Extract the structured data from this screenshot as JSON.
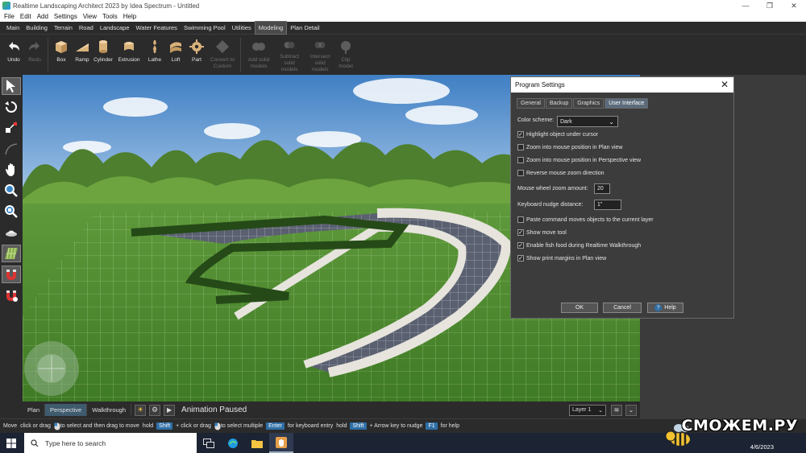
{
  "window": {
    "title": "Realtime Landscaping Architect 2023 by Idea Spectrum - Untitled",
    "controls": [
      "—",
      "❐",
      "✕"
    ]
  },
  "menu": [
    "File",
    "Edit",
    "Add",
    "Settings",
    "View",
    "Tools",
    "Help"
  ],
  "tabs": [
    "Main",
    "Building",
    "Terrain",
    "Road",
    "Landscape",
    "Water Features",
    "Swimming Pool",
    "Utilities",
    "Modeling",
    "Plan Detail"
  ],
  "active_tab": "Modeling",
  "toolbar": {
    "undo": "Undo",
    "redo": "Redo",
    "box": "Box",
    "ramp": "Ramp",
    "cylinder": "Cylinder",
    "extrusion": "Extrusion",
    "lathe": "Lathe",
    "loft": "Loft",
    "part": "Part",
    "convert1": "Convert to",
    "convert2": "Custom",
    "add1": "Add solid",
    "add2": "models",
    "sub1": "Subtract solid",
    "sub2": "models",
    "int1": "Intersect solid",
    "int2": "models",
    "clip1": "Clip",
    "clip2": "model"
  },
  "viewport_tabs": {
    "plan": "Plan",
    "perspective": "Perspective",
    "walkthrough": "Walkthrough"
  },
  "animation_status": "Animation Paused",
  "layer": "Layer 1",
  "status": {
    "mode": "Move",
    "t1": "click or drag",
    "t2": "to select and then drag to move",
    "t3": "hold",
    "k1": "Shift",
    "t4": "+ click or drag",
    "t5": "to select multiple",
    "k2": "Enter",
    "t6": "for keyboard entry",
    "t7": "hold",
    "k3": "Shift",
    "t8": "+ Arrow key to nudge",
    "k4": "F1",
    "t9": "for help"
  },
  "taskbar": {
    "search_placeholder": "Type here to search",
    "date": "4/6/2023",
    "watermark": "СМОЖЕМ.РУ"
  },
  "dialog": {
    "title": "Program Settings",
    "tabs": [
      "General",
      "Backup",
      "Graphics",
      "User Interface"
    ],
    "active_tab": "User Interface",
    "color_scheme_label": "Color scheme:",
    "color_scheme_value": "Dark",
    "options": [
      {
        "label": "Highlight object under cursor",
        "checked": true
      },
      {
        "label": "Zoom into mouse position in Plan view",
        "checked": false
      },
      {
        "label": "Zoom into mouse position in Perspective view",
        "checked": false
      },
      {
        "label": "Reverse mouse zoom direction",
        "checked": false
      }
    ],
    "zoom_label": "Mouse wheel zoom amount:",
    "zoom_value": "20",
    "nudge_label": "Keyboard nudge distance:",
    "nudge_value": "1\"",
    "options2": [
      {
        "label": "Paste command moves objects to the current layer",
        "checked": false
      },
      {
        "label": "Show move tool",
        "checked": true
      },
      {
        "label": "Enable fish food during Realtime Walkthrough",
        "checked": true
      },
      {
        "label": "Show print margins in Plan view",
        "checked": true
      }
    ],
    "ok": "OK",
    "cancel": "Cancel",
    "help": "Help"
  },
  "colors": {
    "accent": "#2f6fa6",
    "panel": "#2b2b2b",
    "dialog": "#3c3c3c"
  }
}
